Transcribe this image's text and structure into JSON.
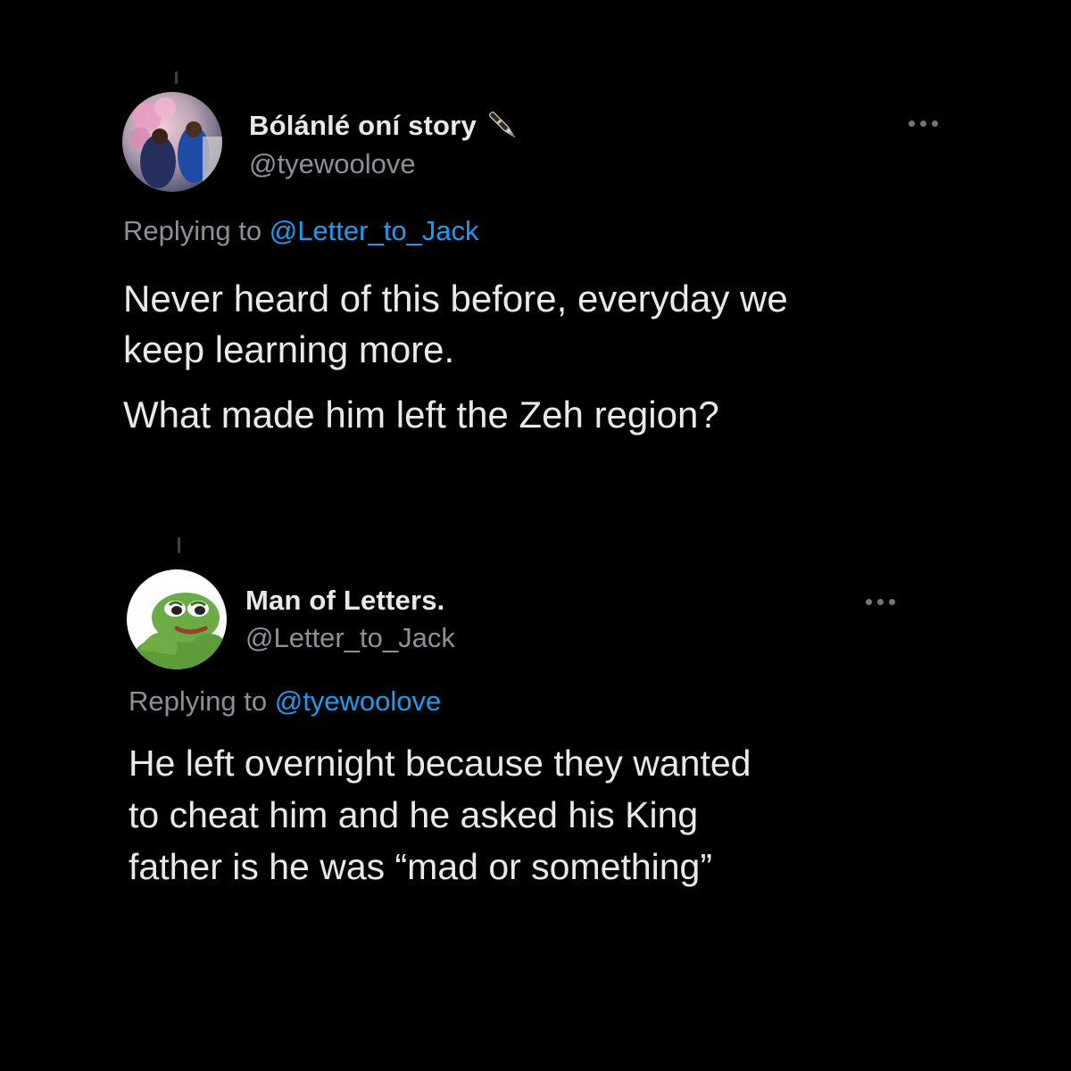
{
  "tweets": [
    {
      "display_name": "Bólánlé oní story",
      "name_emoji_icon": "fountain-pen-icon",
      "handle": "@tyewoolove",
      "replying_prefix": "Replying to",
      "replying_to": "@Letter_to_Jack",
      "paragraphs": [
        "Never heard of this before, everyday we\nkeep learning more.",
        "What made him left the Zeh region?"
      ]
    },
    {
      "display_name": "Man of Letters.",
      "handle": "@Letter_to_Jack",
      "replying_prefix": "Replying to",
      "replying_to": "@tyewoolove",
      "paragraphs": [
        "He left overnight because they wanted\nto cheat him and he asked his King\nfather is he was “mad or something”"
      ]
    }
  ],
  "colors": {
    "background": "#000000",
    "text": "#e7e9ea",
    "muted": "#8b9197",
    "link": "#1d9bf0"
  }
}
